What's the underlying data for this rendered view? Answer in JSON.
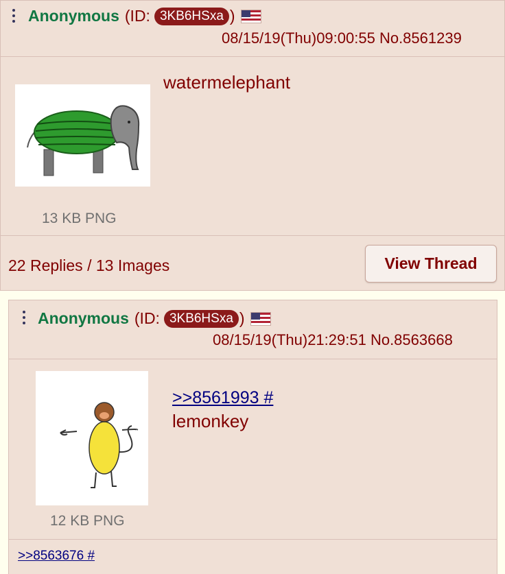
{
  "posts": [
    {
      "name": "Anonymous",
      "id_prefix": "(ID:",
      "id_value": "3KB6HSxa",
      "id_suffix": ")",
      "flag_icon": "us-flag-icon",
      "dateline": "08/15/19(Thu)09:00:55 No.8561239",
      "comment": "watermelephant",
      "file_info": "13 KB PNG",
      "thumb_icon": "watermelon-elephant-drawing",
      "reply_summary": "22 Replies / 13 Images",
      "view_thread_label": "View Thread"
    },
    {
      "name": "Anonymous",
      "id_prefix": "(ID:",
      "id_value": "3KB6HSxa",
      "id_suffix": ")",
      "flag_icon": "us-flag-icon",
      "dateline": "08/15/19(Thu)21:29:51 No.8563668",
      "quote_link": ">>8561993 #",
      "comment": "lemonkey",
      "file_info": "12 KB PNG",
      "thumb_icon": "lemon-monkey-drawing",
      "backlink": ">>8563676 #"
    }
  ],
  "colors": {
    "page_bg": "#ffffee",
    "post_bg": "#f0e0d6",
    "name": "#117743",
    "text": "#800000",
    "link": "#000080",
    "id_pill": "#8b1a1a"
  }
}
